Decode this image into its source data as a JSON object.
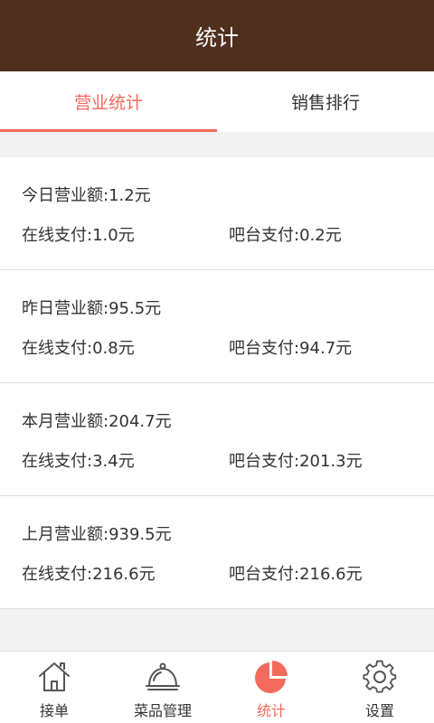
{
  "header": {
    "title": "统计"
  },
  "tabs": [
    {
      "label": "营业统计",
      "active": true
    },
    {
      "label": "销售排行",
      "active": false
    }
  ],
  "stats": [
    {
      "total": "今日营业额:1.2元",
      "online": "在线支付:1.0元",
      "bar": "吧台支付:0.2元"
    },
    {
      "total": "昨日营业额:95.5元",
      "online": "在线支付:0.8元",
      "bar": "吧台支付:94.7元"
    },
    {
      "total": "本月营业额:204.7元",
      "online": "在线支付:3.4元",
      "bar": "吧台支付:201.3元"
    },
    {
      "total": "上月营业额:939.5元",
      "online": "在线支付:216.6元",
      "bar": "吧台支付:216.6元"
    }
  ],
  "bottom_nav": [
    {
      "label": "接单",
      "icon": "home-icon"
    },
    {
      "label": "菜品管理",
      "icon": "cloche-icon"
    },
    {
      "label": "统计",
      "icon": "pie-chart-icon",
      "active": true
    },
    {
      "label": "设置",
      "icon": "gear-icon"
    }
  ],
  "colors": {
    "header_bg": "#4f2f1e",
    "accent": "#f46a5c"
  }
}
